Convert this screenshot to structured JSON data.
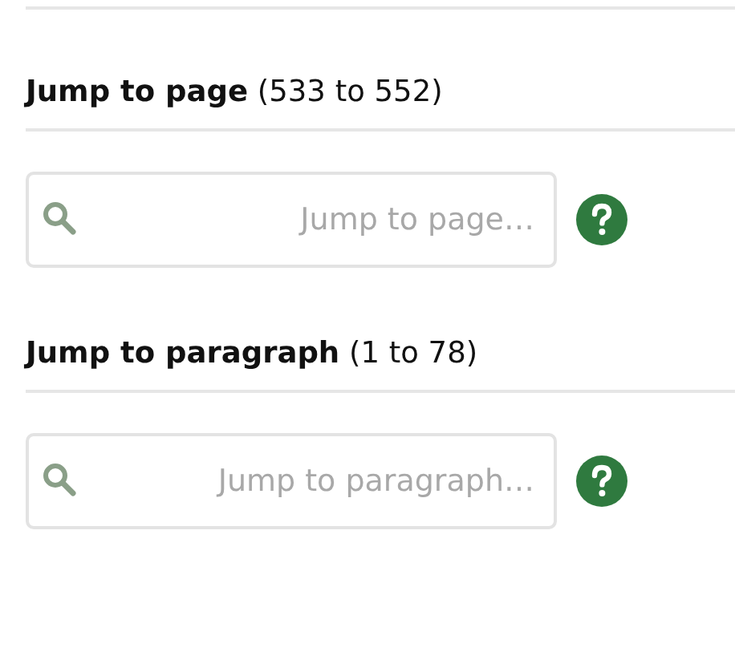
{
  "sections": [
    {
      "heading": "**Jump to page** (533 to 552)",
      "search": {
        "placeholder": "Jump to page…"
      }
    },
    {
      "heading": "**Jump to paragraph** (1 to 78)",
      "search": {
        "placeholder": "Jump to paragraph…"
      }
    }
  ]
}
